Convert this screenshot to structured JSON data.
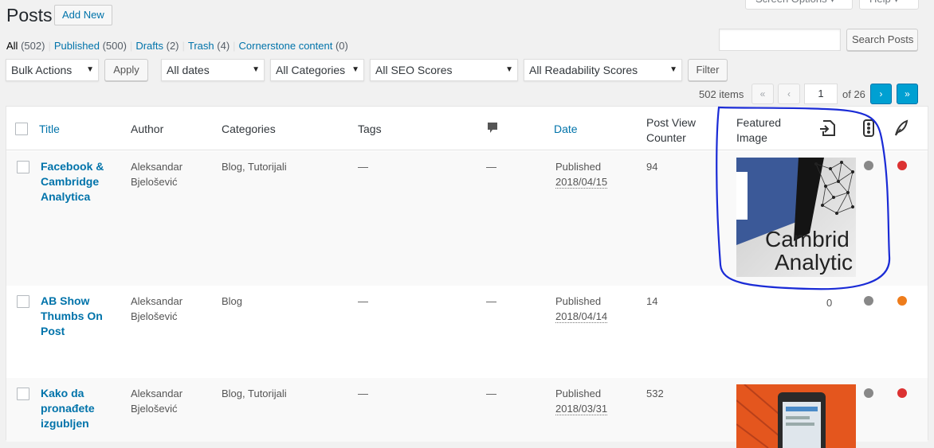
{
  "header": {
    "title": "Posts",
    "add_new": "Add New",
    "screen_options": "Screen Options ▾",
    "help": "Help ▾"
  },
  "views": {
    "all": "All",
    "all_count": "(502)",
    "published": "Published",
    "published_count": "(500)",
    "drafts": "Drafts",
    "drafts_count": "(2)",
    "trash": "Trash",
    "trash_count": "(4)",
    "cornerstone": "Cornerstone content",
    "cornerstone_count": "(0)"
  },
  "search": {
    "value": "",
    "button": "Search Posts"
  },
  "filters": {
    "bulk_actions": "Bulk Actions",
    "apply": "Apply",
    "dates": "All dates",
    "categories": "All Categories",
    "seo": "All SEO Scores",
    "readability": "All Readability Scores",
    "filter": "Filter"
  },
  "pagination": {
    "items": "502 items",
    "first": "«",
    "prev": "‹",
    "current_page": "1",
    "of": "of 26",
    "next": "›",
    "last": "»"
  },
  "columns": {
    "title": "Title",
    "author": "Author",
    "categories": "Categories",
    "tags": "Tags",
    "date": "Date",
    "post_view_line1": "Post View",
    "post_view_line2": "Counter",
    "featured_line1": "Featured",
    "featured_line2": "Image"
  },
  "rows": [
    {
      "title_lines": [
        "Facebook &",
        "Cambridge",
        "Analytica"
      ],
      "author_lines": [
        "Aleksandar",
        "Bjelošević"
      ],
      "categories": "Blog, Tutorijali",
      "tags": "—",
      "comments": "—",
      "status": "Published",
      "date": "2018/04/15",
      "views": "94",
      "image_text_1": "Cambrid",
      "image_text_2": "Analytic",
      "seo_color": "#888888",
      "readability_color": "#dc3232"
    },
    {
      "title_lines": [
        "AB Show",
        "Thumbs On",
        "Post"
      ],
      "author_lines": [
        "Aleksandar",
        "Bjelošević"
      ],
      "categories": "Blog",
      "tags": "—",
      "comments": "—",
      "status": "Published",
      "date": "2018/04/14",
      "views": "14",
      "links_count": "0",
      "seo_color": "#888888",
      "readability_color": "#ee7c1b"
    },
    {
      "title_lines": [
        "Kako da",
        "pronađete",
        "izgubljen"
      ],
      "author_lines": [
        "Aleksandar",
        "Bjelošević"
      ],
      "categories": "Blog, Tutorijali",
      "tags": "—",
      "comments": "—",
      "status": "Published",
      "date": "2018/03/31",
      "views": "532",
      "seo_color": "#888888",
      "readability_color": "#dc3232"
    }
  ],
  "icons": {
    "comments": "comment-bubble-icon",
    "links": "internal-links-icon",
    "seo": "seo-score-icon",
    "readability": "readability-feather-icon"
  },
  "annotation_color": "#1a2bd6"
}
